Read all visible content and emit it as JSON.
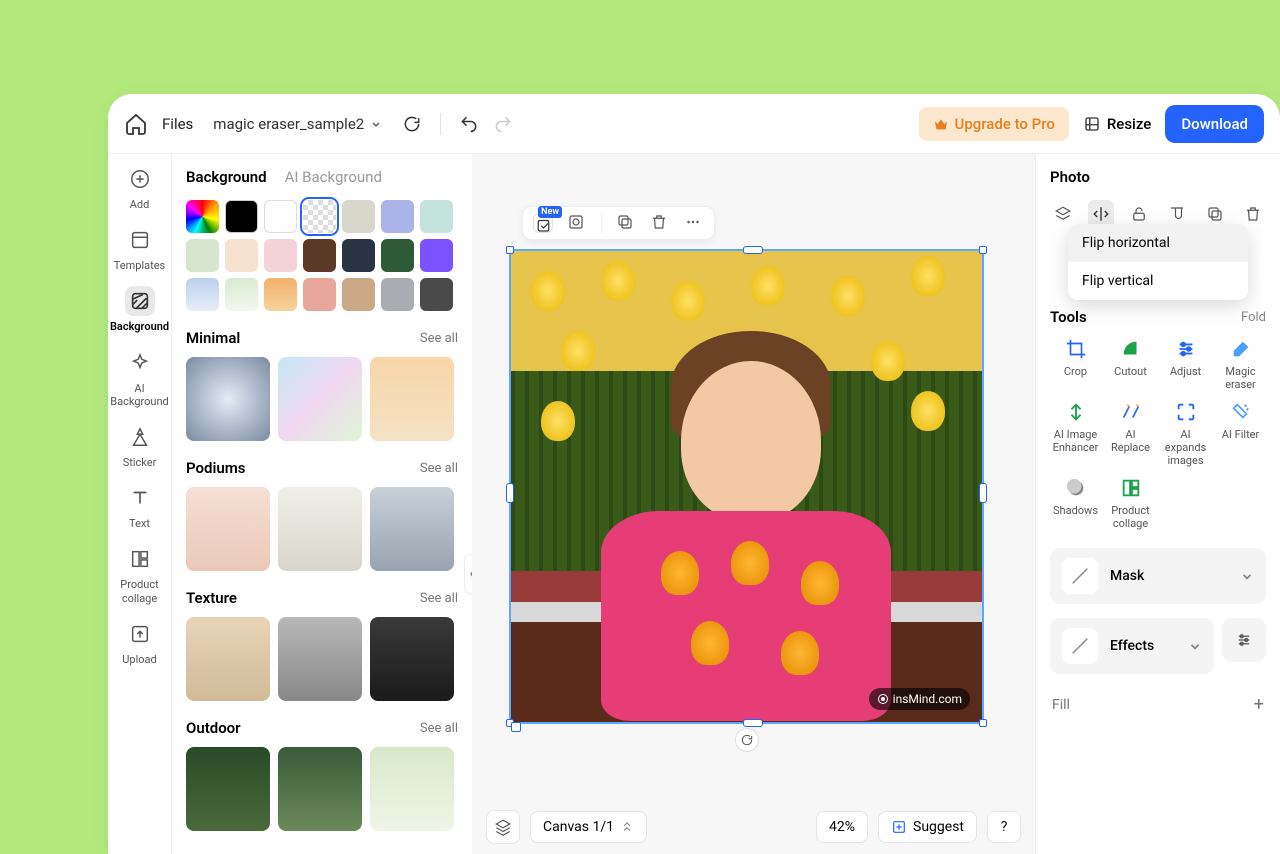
{
  "topbar": {
    "files_label": "Files",
    "file_name": "magic eraser_sample2",
    "upgrade_label": "Upgrade to Pro",
    "resize_label": "Resize",
    "download_label": "Download"
  },
  "left_rail": [
    {
      "id": "add",
      "label": "Add"
    },
    {
      "id": "templates",
      "label": "Templates"
    },
    {
      "id": "background",
      "label": "Background"
    },
    {
      "id": "ai-background",
      "label": "AI Background"
    },
    {
      "id": "sticker",
      "label": "Sticker"
    },
    {
      "id": "text",
      "label": "Text"
    },
    {
      "id": "product-collage",
      "label": "Product collage"
    },
    {
      "id": "upload",
      "label": "Upload"
    }
  ],
  "bg_panel": {
    "tab_background": "Background",
    "tab_ai_background": "AI Background",
    "swatches": [
      "rainbow",
      "#000000",
      "#ffffff",
      "checker",
      "#d9d6cc",
      "#aab4e8",
      "#c3e3dc",
      "#d7e4cf",
      "#f7e2cf",
      "#f5d2d7",
      "#5a3a27",
      "#2a3344",
      "#2f5a38",
      "#7a52ff",
      "#bcd0ea",
      "#d7ead2",
      "#f2b06a",
      "#e8a79a",
      "#cba986",
      "#a9acb1",
      "#4a4a4a"
    ],
    "selected_swatch_index": 3,
    "see_all_label": "See all",
    "sections": {
      "minimal": "Minimal",
      "podiums": "Podiums",
      "texture": "Texture",
      "outdoor": "Outdoor"
    }
  },
  "canvas_toolbar": {
    "new_badge": "New"
  },
  "watermark": "insMind.com",
  "bottom_bar": {
    "canvas_label": "Canvas 1/1",
    "zoom_label": "42%",
    "suggest_label": "Suggest",
    "help_label": "?"
  },
  "right_panel": {
    "title": "Photo",
    "flip_menu": {
      "flip_h": "Flip horizontal",
      "flip_v": "Flip vertical"
    },
    "tools_title": "Tools",
    "fold_label": "Fold",
    "tools": [
      {
        "id": "crop",
        "label": "Crop"
      },
      {
        "id": "cutout",
        "label": "Cutout"
      },
      {
        "id": "adjust",
        "label": "Adjust"
      },
      {
        "id": "magic-eraser",
        "label": "Magic eraser"
      },
      {
        "id": "ai-enhancer",
        "label": "AI Image Enhancer"
      },
      {
        "id": "ai-replace",
        "label": "AI Replace"
      },
      {
        "id": "ai-expand",
        "label": "AI expands images"
      },
      {
        "id": "ai-filter",
        "label": "AI Filter"
      },
      {
        "id": "shadows",
        "label": "Shadows"
      },
      {
        "id": "product-collage",
        "label": "Product collage"
      }
    ],
    "mask_label": "Mask",
    "effects_label": "Effects",
    "fill_label": "Fill"
  }
}
